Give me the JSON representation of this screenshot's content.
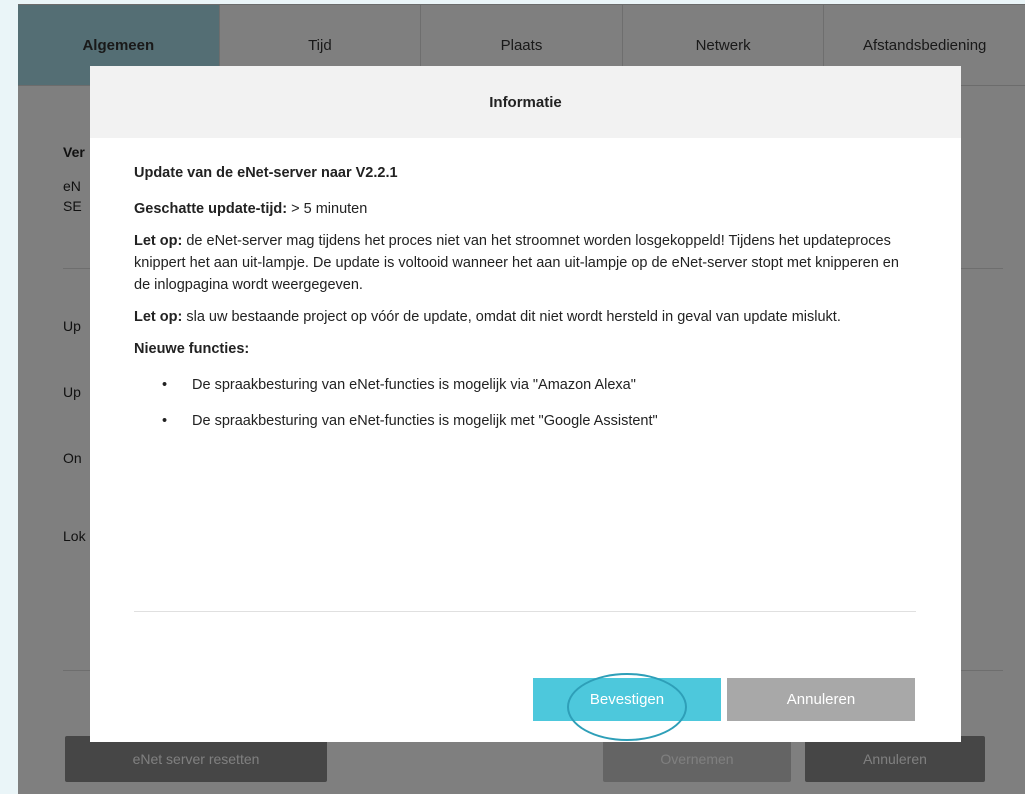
{
  "tabs": [
    {
      "label": "Algemeen",
      "active": true
    },
    {
      "label": "Tijd",
      "active": false
    },
    {
      "label": "Plaats",
      "active": false
    },
    {
      "label": "Netwerk",
      "active": false
    },
    {
      "label": "Afstandsbediening",
      "active": false
    }
  ],
  "background": {
    "labels": [
      "Ver",
      "eN",
      "SE",
      "Up",
      "Up",
      "On",
      "Lok"
    ],
    "reset_button": "eNet server resetten",
    "apply_button": "Overnemen",
    "cancel_button": "Annuleren"
  },
  "modal": {
    "header": "Informatie",
    "title": "Update van de eNet-server naar V2.2.1",
    "duration_label": "Geschatte update-tijd:",
    "duration_value": "> 5 minuten",
    "note1_label": "Let op:",
    "note1_text": "de eNet-server mag tijdens het proces niet van het stroomnet worden losgekoppeld! Tijdens het updateproces knippert het aan uit-lampje. De update is voltooid wanneer het aan uit-lampje op de eNet-server stopt met knipperen en de inlogpagina wordt weergegeven.",
    "note2_label": "Let op:",
    "note2_text": "sla uw bestaande project op vóór de update, omdat dit niet wordt hersteld in geval van update mislukt.",
    "features_heading": "Nieuwe functies:",
    "features": [
      "De spraakbesturing van eNet-functies is mogelijk via \"Amazon Alexa\"",
      "De spraakbesturing van eNet-functies is mogelijk met \"Google Assistent\""
    ],
    "bullet": "•",
    "confirm_button": "Bevestigen",
    "cancel_button": "Annuleren"
  },
  "colors": {
    "active_tab": "#a8dde8",
    "confirm": "#4dc8dc",
    "cancel": "#a8a8a8",
    "highlight_ring": "#2e9fb8"
  }
}
